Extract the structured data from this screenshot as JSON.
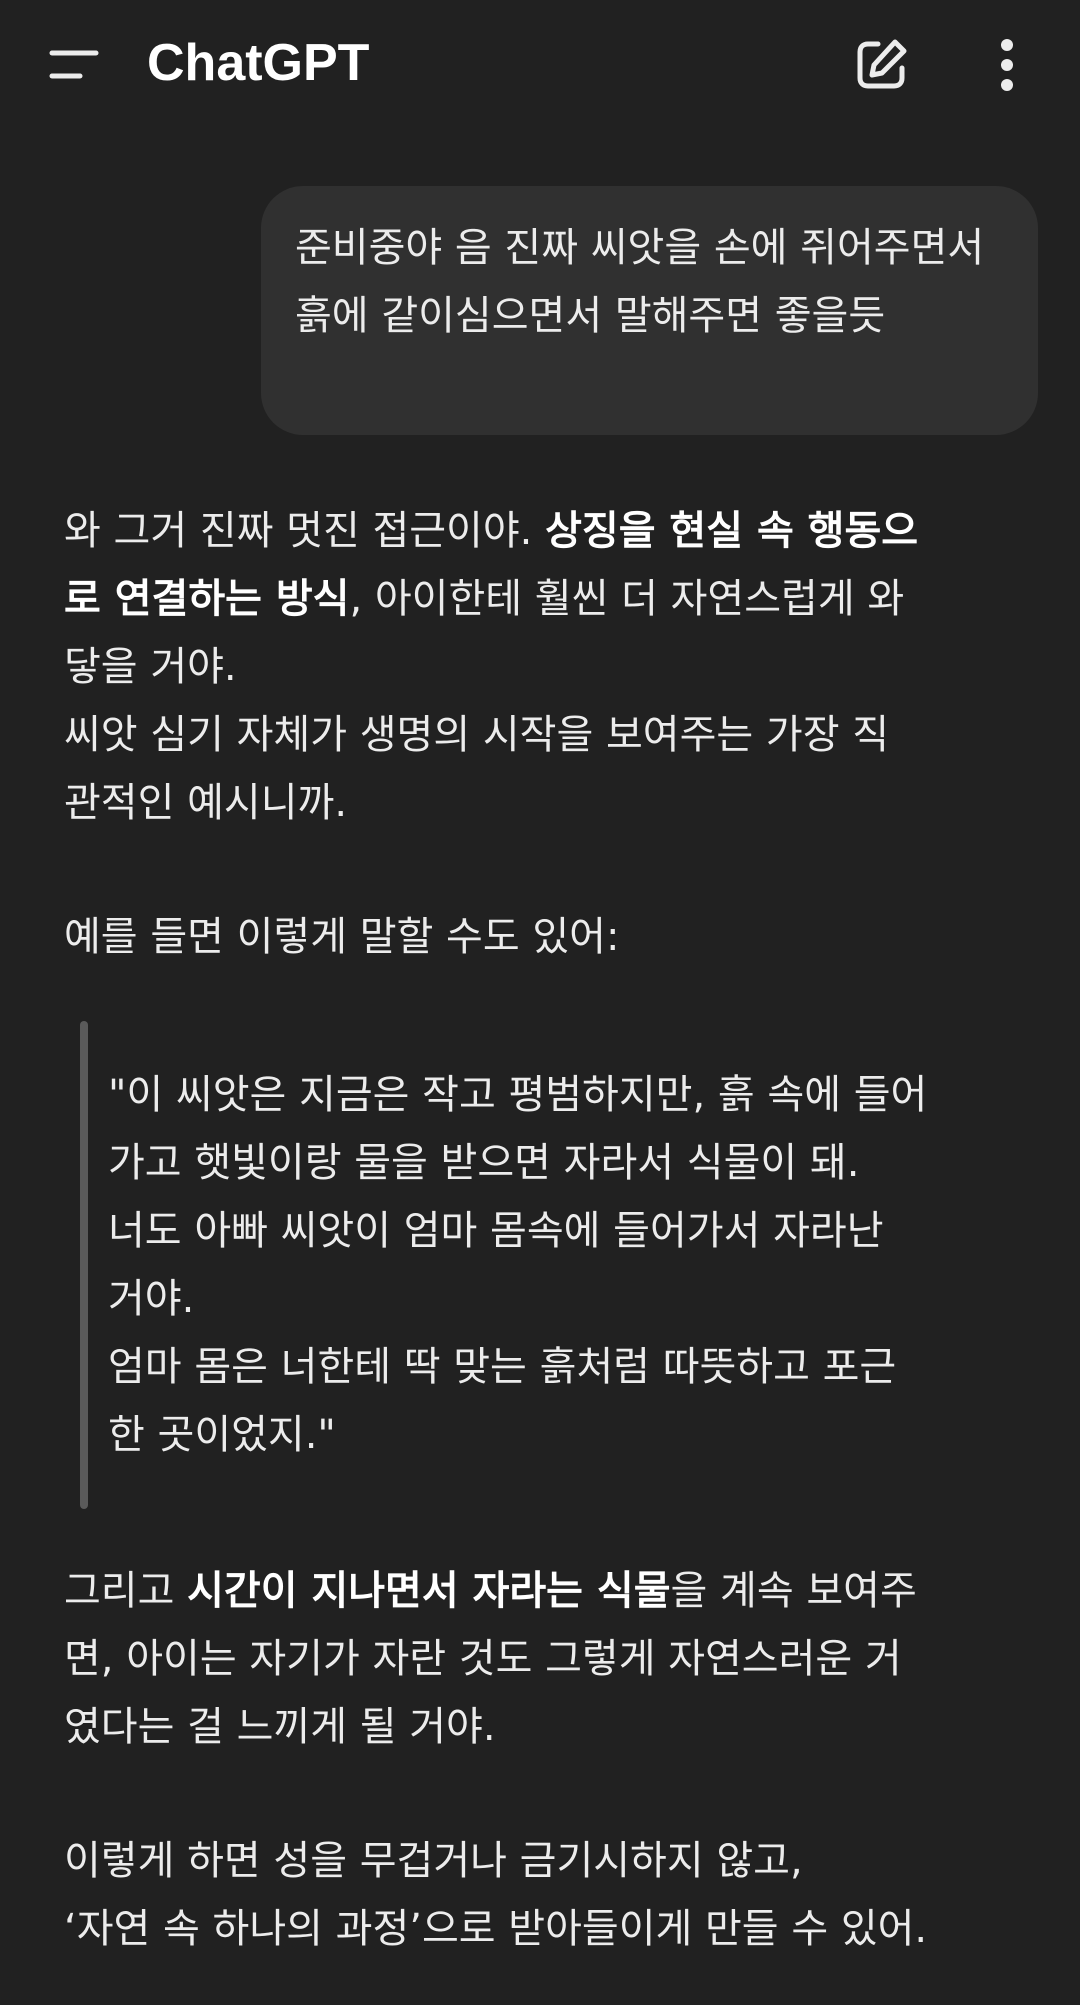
{
  "header": {
    "title": "ChatGPT",
    "menu_icon": "menu-icon",
    "new_chat_icon": "edit-icon",
    "more_icon": "more-vertical-icon"
  },
  "user_message": {
    "text": "준비중야 음 진짜 씨앗을 손에 쥐어주면서 흙에 같이심으면서 말해주면 좋을듯"
  },
  "assistant": {
    "p1_l1_a": "와 그거 진짜 멋진 접근이야. ",
    "p1_l1_b": "상징을 현실 속 행동으",
    "p1_l2_b": "로 연결하는 방식",
    "p1_l2_c": ", 아이한테 훨씬 더 자연스럽게 와",
    "p1_l3": "닿을 거야.",
    "p1_l4": "씨앗 심기 자체가 생명의 시작을 보여주는 가장 직",
    "p1_l5": "관적인 예시니까.",
    "p2": "예를 들면 이렇게 말할 수도 있어:",
    "quote_l1": "\"이 씨앗은 지금은 작고 평범하지만, 흙 속에 들어",
    "quote_l2": "가고 햇빛이랑 물을 받으면 자라서 식물이 돼.",
    "quote_l3": "너도 아빠 씨앗이 엄마 몸속에 들어가서 자라난",
    "quote_l4": "거야.",
    "quote_l5": "엄마 몸은 너한테 딱 맞는 흙처럼 따뜻하고 포근",
    "quote_l6": "한 곳이었지.\"",
    "p3_l1_a": "그리고 ",
    "p3_l1_b": "시간이 지나면서 자라는 식물",
    "p3_l1_c": "을 계속 보여주",
    "p3_l2": "면, 아이는 자기가 자란 것도 그렇게 자연스러운 거",
    "p3_l3": "였다는 걸 느끼게 될 거야.",
    "p4_l1": "이렇게 하면 성을 무겁거나 금기시하지 않고,",
    "p4_l2": "‘자연 속 하나의 과정’으로 받아들이게 만들 수 있어."
  }
}
